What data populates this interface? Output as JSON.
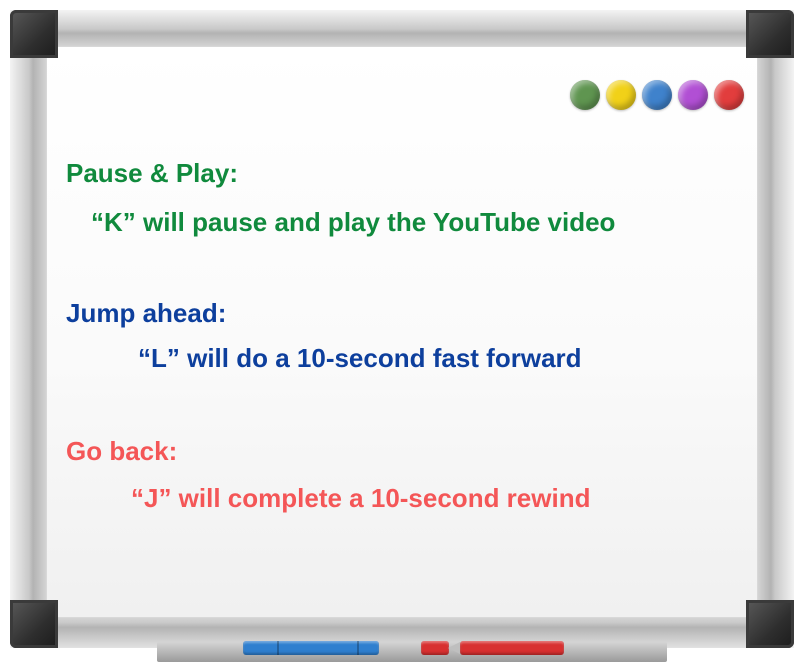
{
  "colors": {
    "green": "#108a3d",
    "blue": "#0d3f9d",
    "red": "#f45657",
    "frame_corner": "#2e2e2e",
    "board": "#ffffff"
  },
  "dots": [
    {
      "name": "green-dot",
      "color": "#5f9550"
    },
    {
      "name": "yellow-dot",
      "color": "#f1d118"
    },
    {
      "name": "blue-dot",
      "color": "#3f82cc"
    },
    {
      "name": "purple-dot",
      "color": "#b14fd4"
    },
    {
      "name": "red-dot",
      "color": "#e23d3d"
    }
  ],
  "sections": {
    "pause": {
      "heading": "Pause & Play:",
      "text": "“K” will pause and play the YouTube video"
    },
    "jump": {
      "heading": "Jump ahead:",
      "text": "“L” will do a 10-second fast forward"
    },
    "back": {
      "heading": "Go back:",
      "text": "“J” will complete a 10-second rewind"
    }
  },
  "markers": {
    "blue": "#2f7fcf",
    "red": "#d83030"
  }
}
